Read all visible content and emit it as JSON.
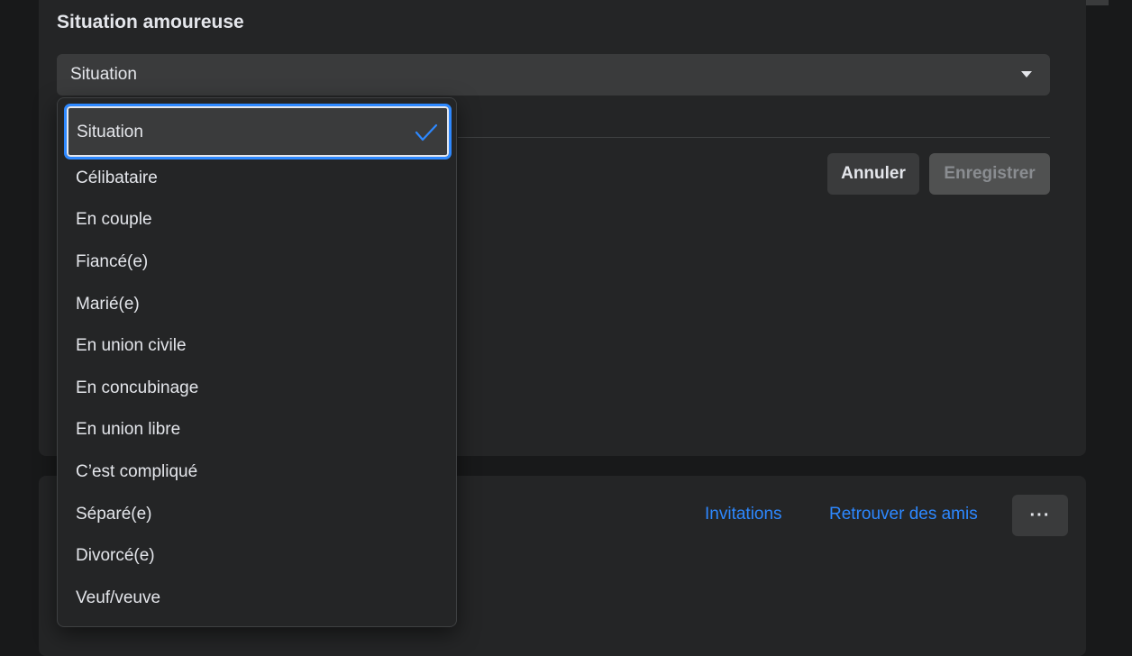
{
  "section": {
    "title": "Situation amoureuse"
  },
  "select": {
    "value": "Situation"
  },
  "buttons": {
    "cancel": "Annuler",
    "save": "Enregistrer"
  },
  "links": {
    "invitations": "Invitations",
    "find_friends": "Retrouver des amis",
    "more": "···"
  },
  "dropdown": {
    "selected": "Situation",
    "options": [
      "Célibataire",
      "En couple",
      "Fiancé(e)",
      "Marié(e)",
      "En union civile",
      "En concubinage",
      "En union libre",
      "C’est compliqué",
      "Séparé(e)",
      "Divorcé(e)",
      "Veuf/veuve"
    ]
  },
  "colors": {
    "accent": "#2d88ff",
    "card": "#242526",
    "field": "#3a3b3c"
  },
  "icons": {
    "check": "check-icon",
    "caret": "caret-down-icon",
    "more": "more-horizontal-icon"
  }
}
